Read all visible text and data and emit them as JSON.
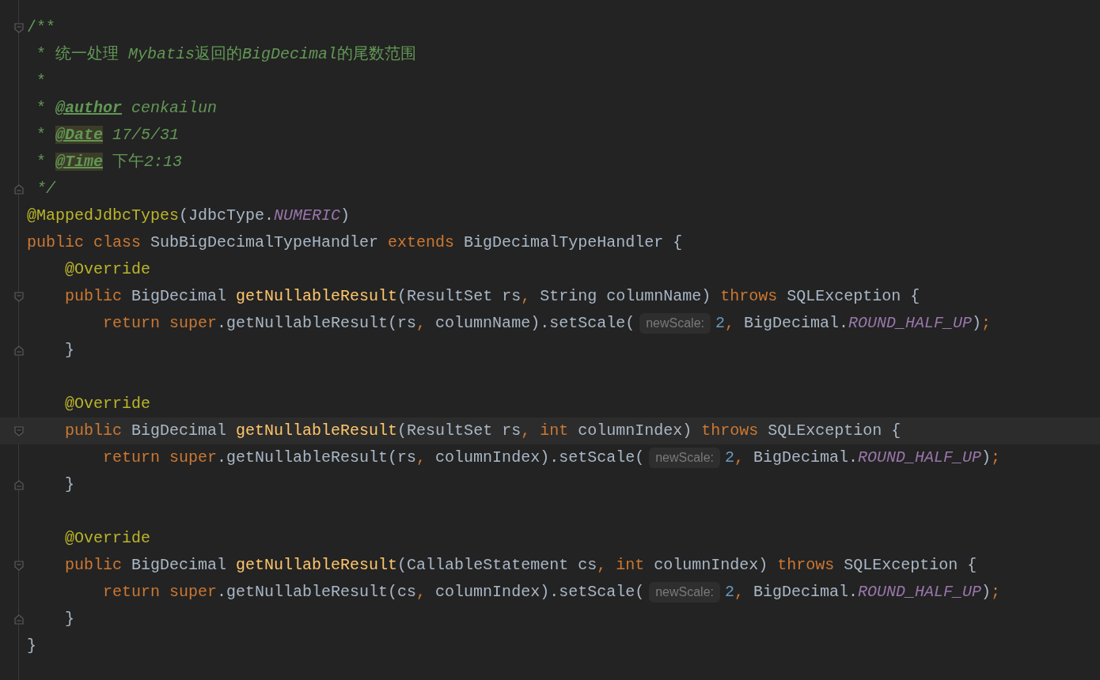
{
  "editor": {
    "lines": [
      {
        "kind": "fold-start",
        "current": false,
        "tokens": [
          {
            "kind": "comment",
            "text": "/**"
          }
        ]
      },
      {
        "kind": "line",
        "current": false,
        "tokens": [
          {
            "kind": "comment",
            "text": " * 统一处理 "
          },
          {
            "kind": "comment-italic",
            "text": "Mybatis"
          },
          {
            "kind": "comment",
            "text": "返回的"
          },
          {
            "kind": "comment-italic",
            "text": "BigDecimal"
          },
          {
            "kind": "comment",
            "text": "的尾数范围"
          }
        ]
      },
      {
        "kind": "line",
        "current": false,
        "tokens": [
          {
            "kind": "comment",
            "text": " *"
          }
        ]
      },
      {
        "kind": "line",
        "current": false,
        "tokens": [
          {
            "kind": "comment",
            "text": " * "
          },
          {
            "kind": "doc-tag",
            "text": "@author",
            "highlighted": false
          },
          {
            "kind": "comment-italic",
            "text": " cenkailun"
          }
        ]
      },
      {
        "kind": "line",
        "current": false,
        "tokens": [
          {
            "kind": "comment",
            "text": " * "
          },
          {
            "kind": "doc-tag",
            "text": "@Date",
            "highlighted": true
          },
          {
            "kind": "comment-italic",
            "text": " 17/5/31"
          }
        ]
      },
      {
        "kind": "line",
        "current": false,
        "tokens": [
          {
            "kind": "comment",
            "text": " * "
          },
          {
            "kind": "doc-tag",
            "text": "@Time",
            "highlighted": true
          },
          {
            "kind": "comment",
            "text": " 下午"
          },
          {
            "kind": "comment-italic",
            "text": "2:13"
          }
        ]
      },
      {
        "kind": "fold-end",
        "current": false,
        "tokens": [
          {
            "kind": "comment-italic",
            "text": " */"
          }
        ]
      },
      {
        "kind": "line",
        "current": false,
        "tokens": [
          {
            "kind": "annotation",
            "text": "@MappedJdbcTypes"
          },
          {
            "kind": "plain",
            "text": "(JdbcType."
          },
          {
            "kind": "constant",
            "text": "NUMERIC"
          },
          {
            "kind": "plain",
            "text": ")"
          }
        ]
      },
      {
        "kind": "line",
        "current": false,
        "tokens": [
          {
            "kind": "keyword",
            "text": "public class "
          },
          {
            "kind": "plain",
            "text": "SubBigDecimalTypeHandler "
          },
          {
            "kind": "keyword",
            "text": "extends "
          },
          {
            "kind": "plain",
            "text": "BigDecimalTypeHandler {"
          }
        ]
      },
      {
        "kind": "line",
        "current": false,
        "tokens": [
          {
            "kind": "annotation",
            "text": "    @Override"
          }
        ]
      },
      {
        "kind": "fold-start",
        "current": false,
        "tokens": [
          {
            "kind": "keyword",
            "text": "    public "
          },
          {
            "kind": "plain",
            "text": "BigDecimal "
          },
          {
            "kind": "method",
            "text": "getNullableResult"
          },
          {
            "kind": "plain",
            "text": "(ResultSet rs"
          },
          {
            "kind": "keyword",
            "text": ", "
          },
          {
            "kind": "plain",
            "text": "String columnName) "
          },
          {
            "kind": "keyword",
            "text": "throws "
          },
          {
            "kind": "plain",
            "text": "SQLException {"
          }
        ]
      },
      {
        "kind": "line",
        "current": false,
        "tokens": [
          {
            "kind": "keyword",
            "text": "        return super"
          },
          {
            "kind": "plain",
            "text": ".getNullableResult(rs"
          },
          {
            "kind": "keyword",
            "text": ", "
          },
          {
            "kind": "plain",
            "text": "columnName).setScale("
          },
          {
            "kind": "hint",
            "text": "newScale:"
          },
          {
            "kind": "number",
            "text": "2"
          },
          {
            "kind": "keyword",
            "text": ", "
          },
          {
            "kind": "plain",
            "text": "BigDecimal."
          },
          {
            "kind": "constant",
            "text": "ROUND_HALF_UP"
          },
          {
            "kind": "plain",
            "text": ")"
          },
          {
            "kind": "keyword",
            "text": ";"
          }
        ]
      },
      {
        "kind": "fold-end",
        "current": false,
        "tokens": [
          {
            "kind": "plain",
            "text": "    }"
          }
        ]
      },
      {
        "kind": "line",
        "current": false
      },
      {
        "kind": "line",
        "current": false,
        "tokens": [
          {
            "kind": "annotation",
            "text": "    @Override"
          }
        ]
      },
      {
        "kind": "fold-start",
        "current": true,
        "tokens": [
          {
            "kind": "keyword",
            "text": "    public "
          },
          {
            "kind": "plain",
            "text": "BigDecimal "
          },
          {
            "kind": "method",
            "text": "getNullableResult"
          },
          {
            "kind": "plain",
            "text": "(ResultSet rs"
          },
          {
            "kind": "keyword",
            "text": ", int "
          },
          {
            "kind": "plain",
            "text": "columnIndex) "
          },
          {
            "kind": "keyword",
            "text": "throws "
          },
          {
            "kind": "plain",
            "text": "SQLException {"
          }
        ]
      },
      {
        "kind": "line",
        "current": false,
        "tokens": [
          {
            "kind": "keyword",
            "text": "        return super"
          },
          {
            "kind": "plain",
            "text": ".getNullableResult(rs"
          },
          {
            "kind": "keyword",
            "text": ", "
          },
          {
            "kind": "plain",
            "text": "columnIndex).setScale("
          },
          {
            "kind": "hint",
            "text": "newScale:"
          },
          {
            "kind": "number",
            "text": "2"
          },
          {
            "kind": "keyword",
            "text": ", "
          },
          {
            "kind": "plain",
            "text": "BigDecimal."
          },
          {
            "kind": "constant",
            "text": "ROUND_HALF_UP"
          },
          {
            "kind": "plain",
            "text": ")"
          },
          {
            "kind": "keyword",
            "text": ";"
          }
        ]
      },
      {
        "kind": "fold-end",
        "current": false,
        "tokens": [
          {
            "kind": "plain",
            "text": "    }"
          }
        ]
      },
      {
        "kind": "line",
        "current": false
      },
      {
        "kind": "line",
        "current": false,
        "tokens": [
          {
            "kind": "annotation",
            "text": "    @Override"
          }
        ]
      },
      {
        "kind": "fold-start",
        "current": false,
        "tokens": [
          {
            "kind": "keyword",
            "text": "    public "
          },
          {
            "kind": "plain",
            "text": "BigDecimal "
          },
          {
            "kind": "method",
            "text": "getNullableResult"
          },
          {
            "kind": "plain",
            "text": "(CallableStatement cs"
          },
          {
            "kind": "keyword",
            "text": ", int "
          },
          {
            "kind": "plain",
            "text": "columnIndex) "
          },
          {
            "kind": "keyword",
            "text": "throws "
          },
          {
            "kind": "plain",
            "text": "SQLException {"
          }
        ]
      },
      {
        "kind": "line",
        "current": false,
        "tokens": [
          {
            "kind": "keyword",
            "text": "        return super"
          },
          {
            "kind": "plain",
            "text": ".getNullableResult(cs"
          },
          {
            "kind": "keyword",
            "text": ", "
          },
          {
            "kind": "plain",
            "text": "columnIndex).setScale("
          },
          {
            "kind": "hint",
            "text": "newScale:"
          },
          {
            "kind": "number",
            "text": "2"
          },
          {
            "kind": "keyword",
            "text": ", "
          },
          {
            "kind": "plain",
            "text": "BigDecimal."
          },
          {
            "kind": "constant",
            "text": "ROUND_HALF_UP"
          },
          {
            "kind": "plain",
            "text": ")"
          },
          {
            "kind": "keyword",
            "text": ";"
          }
        ]
      },
      {
        "kind": "fold-end",
        "current": false,
        "tokens": [
          {
            "kind": "plain",
            "text": "    }"
          }
        ]
      },
      {
        "kind": "line",
        "current": false,
        "tokens": [
          {
            "kind": "plain",
            "text": "}"
          }
        ]
      }
    ]
  }
}
